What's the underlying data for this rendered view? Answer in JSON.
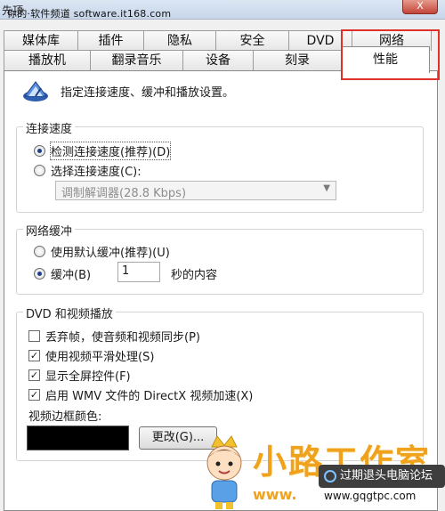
{
  "window": {
    "title_fragment": "先顶",
    "close_label": "X",
    "watermark": "你的·软件频道 software.it168.com"
  },
  "tabs_row1": [
    "媒体库",
    "插件",
    "隐私",
    "安全",
    "DVD",
    "网络"
  ],
  "tabs_row2": [
    "播放机",
    "翻录音乐",
    "设备",
    "刻录",
    "性能"
  ],
  "active_tab": "性能",
  "highlight_color": "#e0302a",
  "intro_text": "指定连接速度、缓冲和播放设置。",
  "connection": {
    "title": "连接速度",
    "option1": "检测连接速度(推荐)(D)",
    "option2": "选择连接速度(C):",
    "selected": "option1",
    "select_value": "调制解调器(28.8 Kbps)"
  },
  "buffering": {
    "title": "网络缓冲",
    "option1": "使用默认缓冲(推荐)(U)",
    "option2_label": "缓冲(B)",
    "selected": "option2",
    "buffer_value": "1",
    "suffix": "秒的内容"
  },
  "dvd": {
    "title": "DVD 和视频播放",
    "checks": [
      {
        "label": "丢弃帧，使音频和视频同步(P)",
        "checked": false
      },
      {
        "label": "使用视频平滑处理(S)",
        "checked": true
      },
      {
        "label": "显示全屏控件(F)",
        "checked": true
      },
      {
        "label": "启用 WMV 文件的 DirectX 视频加速(X)",
        "checked": true
      }
    ],
    "border_color_label": "视频边框颜色:",
    "border_color": "#000000",
    "change_button": "更改(G)..."
  },
  "overlay": {
    "brand": "小路工作室",
    "www": "www.",
    "badge": "过期退头电脑论坛",
    "site": "www.gqgtpc.com"
  }
}
